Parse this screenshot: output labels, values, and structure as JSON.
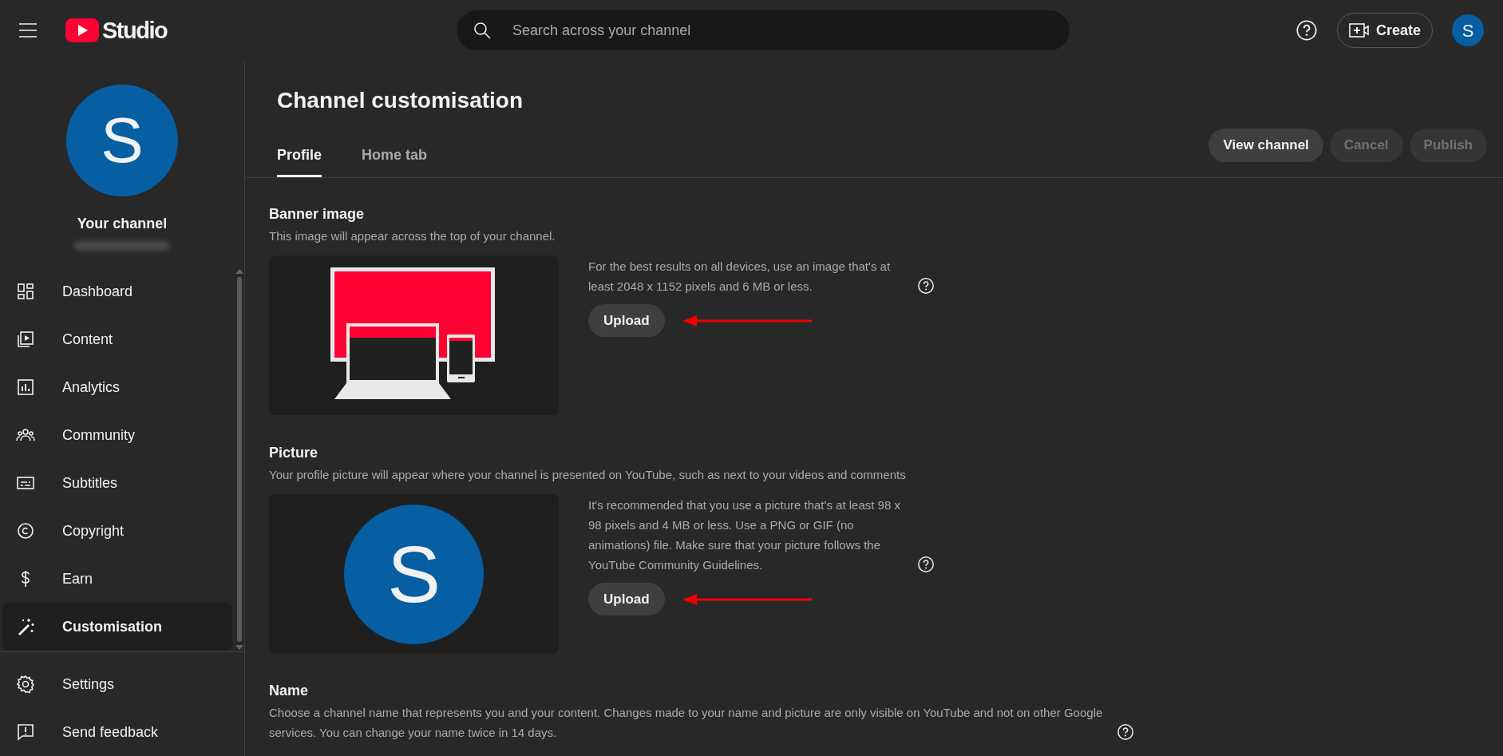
{
  "topbar": {
    "logo_text": "Studio",
    "search": {
      "placeholder": "Search across your channel"
    },
    "create_label": "Create",
    "avatar_letter": "S"
  },
  "sidebar": {
    "avatar_letter": "S",
    "channel_label": "Your channel",
    "items": [
      {
        "label": "Dashboard",
        "selected": false
      },
      {
        "label": "Content",
        "selected": false
      },
      {
        "label": "Analytics",
        "selected": false
      },
      {
        "label": "Community",
        "selected": false
      },
      {
        "label": "Subtitles",
        "selected": false
      },
      {
        "label": "Copyright",
        "selected": false
      },
      {
        "label": "Earn",
        "selected": false
      },
      {
        "label": "Customisation",
        "selected": true
      }
    ],
    "footer_items": [
      {
        "label": "Settings"
      },
      {
        "label": "Send feedback"
      }
    ]
  },
  "page": {
    "title": "Channel customisation",
    "tabs": [
      {
        "label": "Profile",
        "selected": true
      },
      {
        "label": "Home tab",
        "selected": false
      }
    ],
    "actions": [
      {
        "label": "View channel",
        "disabled": false
      },
      {
        "label": "Cancel",
        "disabled": true
      },
      {
        "label": "Publish",
        "disabled": true
      }
    ]
  },
  "sections": [
    {
      "kind": "banner",
      "heading": "Banner image",
      "description": "This image will appear across the top of your channel.",
      "info": "For the best results on all devices, use an image that's at least 2048 x 1152 pixels and 6 MB or less.",
      "upload_label": "Upload"
    },
    {
      "kind": "picture",
      "heading": "Picture",
      "description": "Your profile picture will appear where your channel is presented on YouTube, such as next to your videos and comments",
      "info": "It's recommended that you use a picture that's at least 98 x 98 pixels and 4 MB or less. Use a PNG or GIF (no animations) file. Make sure that your picture follows the YouTube Community Guidelines.",
      "upload_label": "Upload",
      "avatar_letter": "S"
    },
    {
      "kind": "name",
      "heading": "Name",
      "description": "Choose a channel name that represents you and your content. Changes made to your name and picture are only visible on YouTube and not on other Google services. You can change your name twice in 14 days."
    }
  ]
}
